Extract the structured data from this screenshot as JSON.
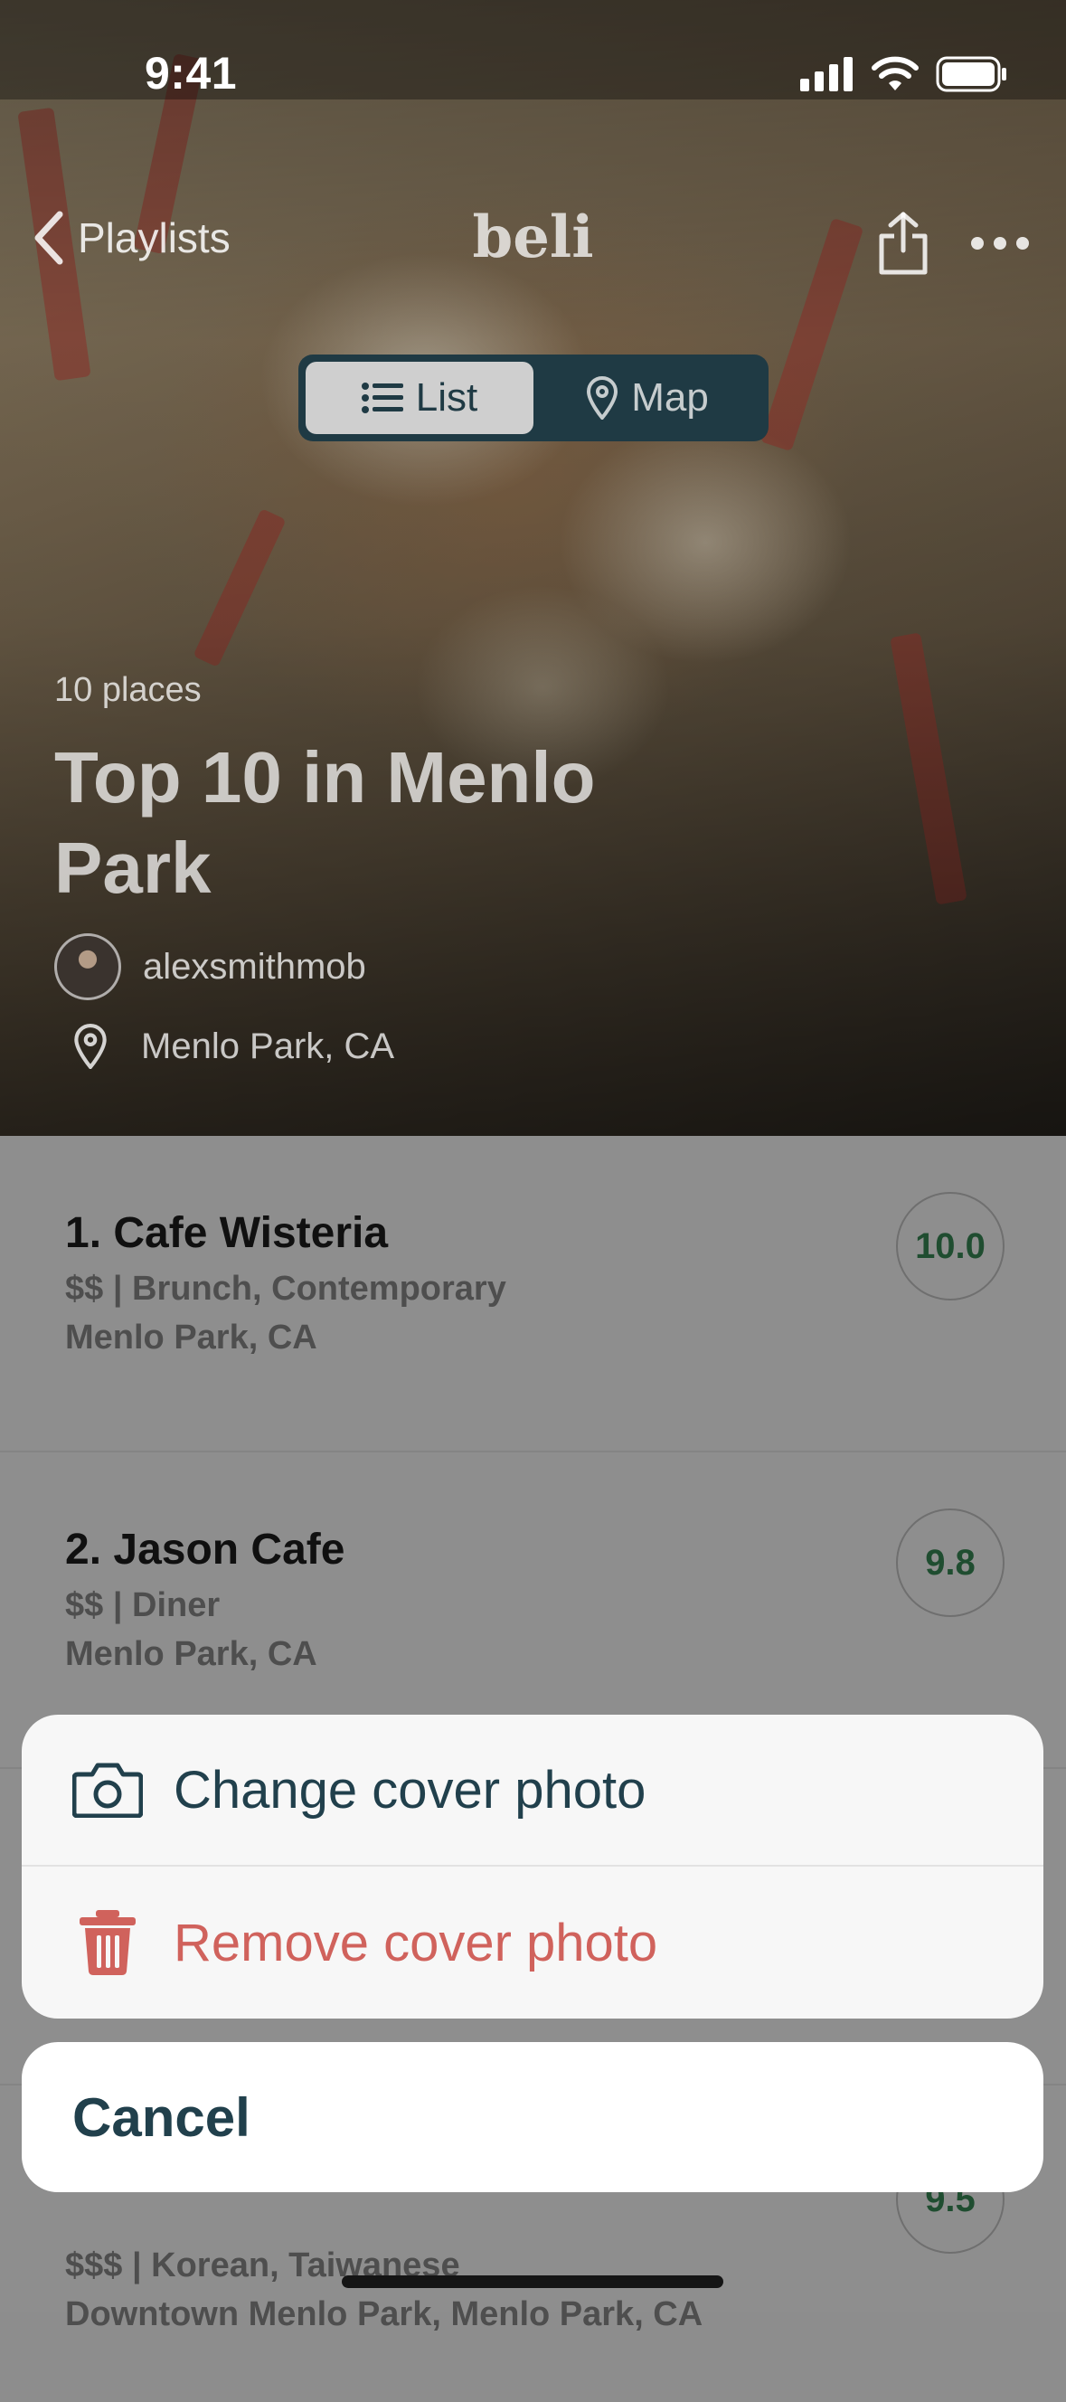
{
  "status_bar": {
    "time": "9:41"
  },
  "nav": {
    "back_label": "Playlists",
    "brand": "beli"
  },
  "view_toggle": {
    "options": [
      {
        "label": "List",
        "icon": "list-icon",
        "selected": true
      },
      {
        "label": "Map",
        "icon": "map-pin-icon",
        "selected": false
      }
    ]
  },
  "playlist": {
    "count_label": "10 places",
    "title": "Top 10 in Menlo Park",
    "owner": "alexsmithmob",
    "location": "Menlo Park, CA"
  },
  "places": [
    {
      "name": "1. Cafe Wisteria",
      "details": "$$ | Brunch, Contemporary",
      "location": "Menlo Park, CA",
      "score": "10.0"
    },
    {
      "name": "2. Jason Cafe",
      "details": "$$ | Diner",
      "location": "Menlo Park, CA",
      "score": "9.8"
    },
    {
      "name": "",
      "details": "$$$ | Korean, Taiwanese",
      "location": "Downtown Menlo Park, Menlo Park, CA",
      "score": "9.5"
    }
  ],
  "action_sheet": {
    "change_label": "Change cover photo",
    "remove_label": "Remove cover photo",
    "cancel_label": "Cancel"
  },
  "colors": {
    "primary": "#21404c",
    "destructive": "#d0625c",
    "score_text": "#1f4d30",
    "segment_bg": "#1f3a44"
  }
}
